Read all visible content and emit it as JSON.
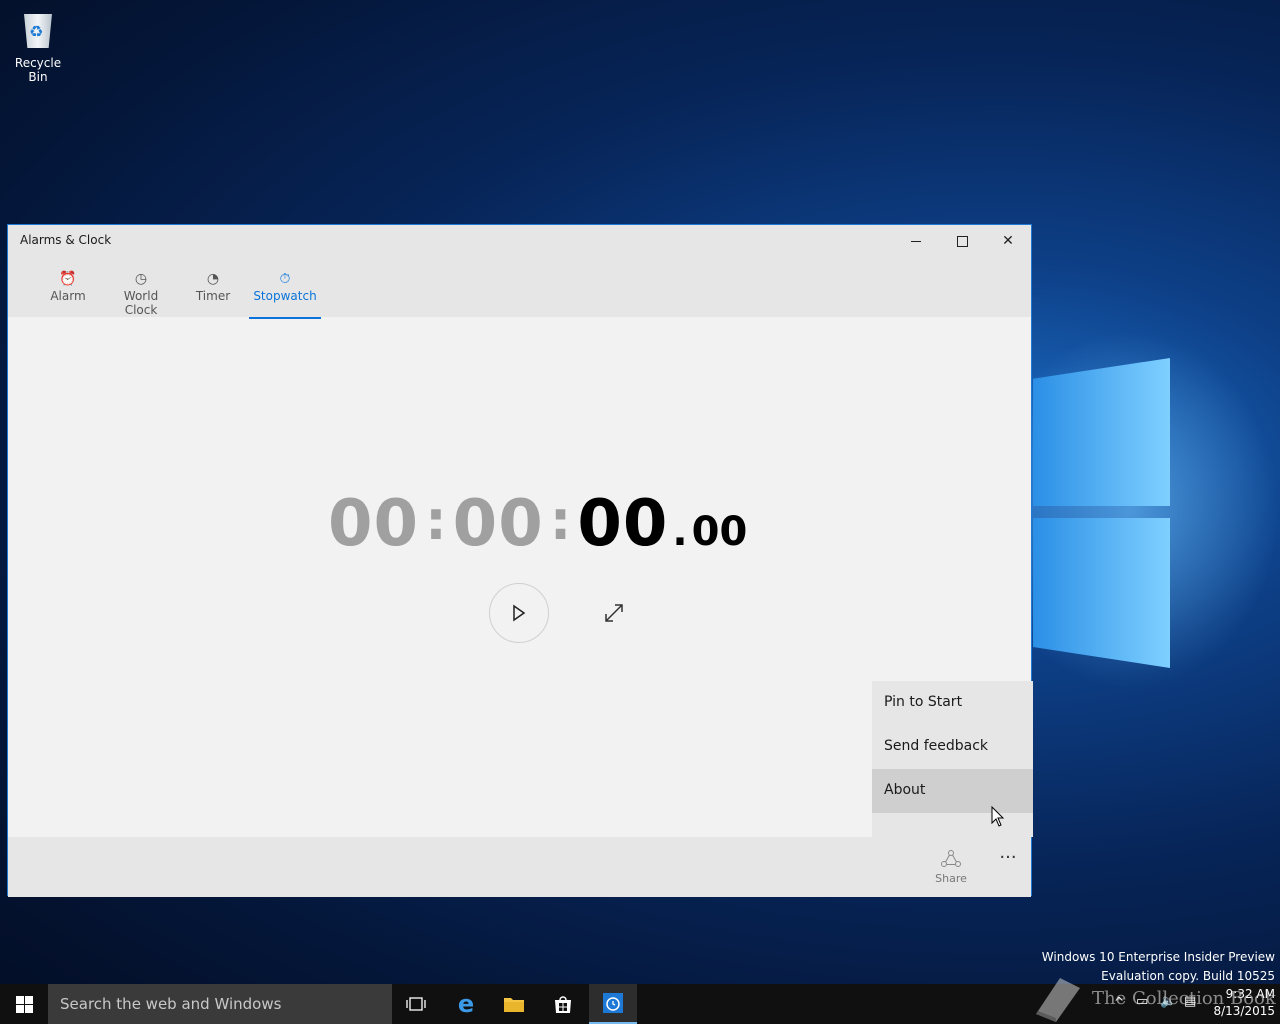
{
  "desktop": {
    "recycle_bin_label": "Recycle Bin"
  },
  "window": {
    "title": "Alarms & Clock",
    "tabs": [
      {
        "label": "Alarm",
        "icon": "alarm-icon"
      },
      {
        "label": "World Clock",
        "icon": "world-clock-icon"
      },
      {
        "label": "Timer",
        "icon": "timer-icon"
      },
      {
        "label": "Stopwatch",
        "icon": "stopwatch-icon",
        "active": true
      }
    ],
    "stopwatch": {
      "hours": "00",
      "minutes": "00",
      "seconds": "00",
      "hundredths": "00",
      "sep": ":",
      "dot": "."
    },
    "menu": {
      "items": [
        "Pin to Start",
        "Send feedback",
        "About"
      ],
      "hovered": "About"
    },
    "appbar": {
      "share_label": "Share",
      "more_label": "···"
    }
  },
  "watermark": {
    "line1": "Windows 10 Enterprise Insider Preview",
    "line2": "Evaluation copy. Build 10525"
  },
  "taskbar": {
    "search_placeholder": "Search the web and Windows",
    "time": "9:32 AM",
    "date": "8/13/2015"
  },
  "overlay": {
    "brand_text": "The Collection Book"
  },
  "colors": {
    "accent": "#0a74da",
    "taskbar": "#101010"
  }
}
